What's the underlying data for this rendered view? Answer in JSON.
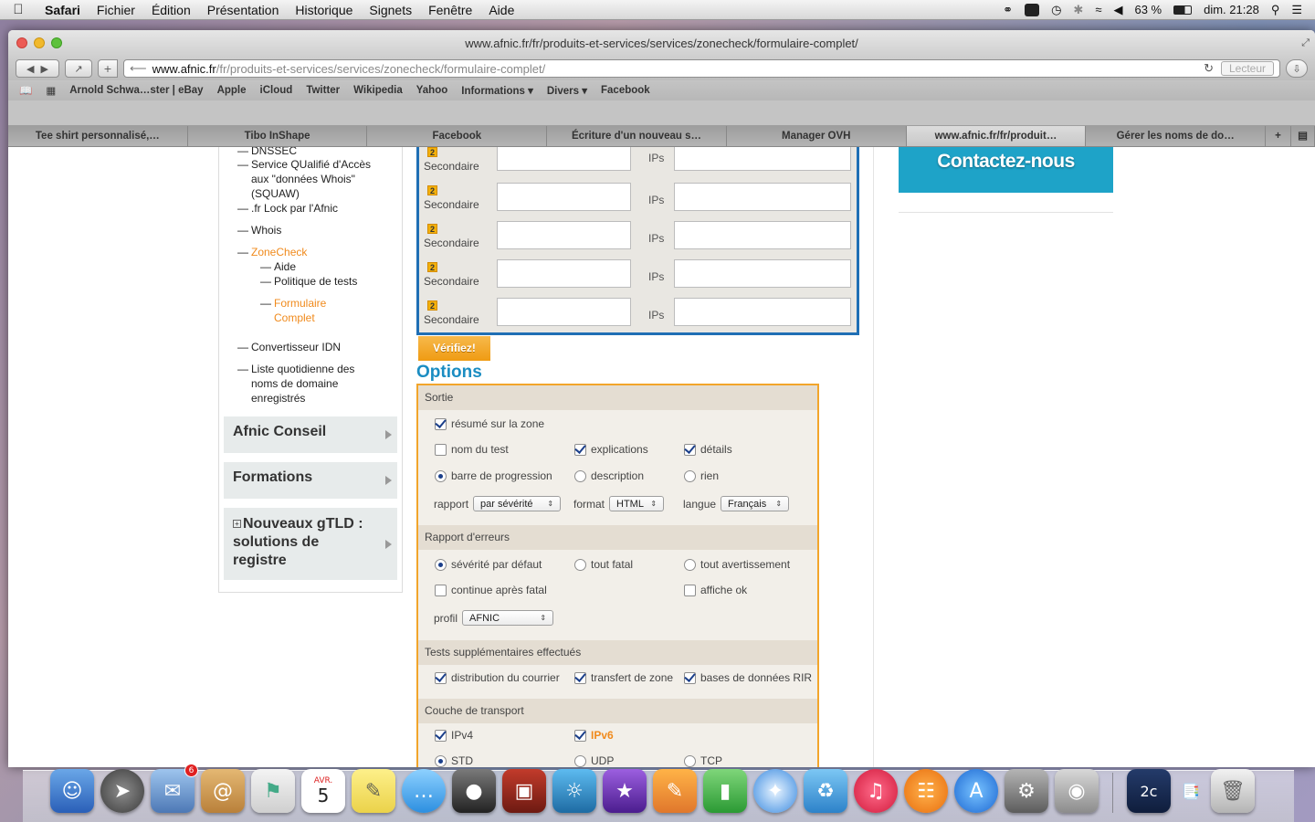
{
  "menubar": {
    "app": "Safari",
    "items": [
      "Fichier",
      "Édition",
      "Présentation",
      "Historique",
      "Signets",
      "Fenêtre",
      "Aide"
    ],
    "battery": "63 %",
    "clock": "dim. 21:28"
  },
  "window": {
    "title": "www.afnic.fr/fr/produits-et-services/services/zonecheck/formulaire-complet/",
    "url_host": "www.afnic.fr",
    "url_path": "/fr/produits-et-services/services/zonecheck/formulaire-complet/",
    "reader_label": "Lecteur"
  },
  "bookmarks": [
    "Arnold Schwa…ster | eBay",
    "Apple",
    "iCloud",
    "Twitter",
    "Wikipedia",
    "Yahoo",
    "Informations ▾",
    "Divers ▾",
    "Facebook"
  ],
  "tabs": [
    "Tee shirt personnalisé,…",
    "Tibo InShape",
    "Facebook",
    "Écriture d'un nouveau s…",
    "Manager OVH",
    "www.afnic.fr/fr/produit…",
    "Gérer les noms de do…"
  ],
  "sidebar": {
    "items": [
      {
        "dash": "—",
        "text": "DNSSEC"
      },
      {
        "dash": "—",
        "text": "Service QUalifié d'Accès aux \"données Whois\" (SQUAW)"
      },
      {
        "dash": "—",
        "text": ".fr Lock par l'Afnic"
      },
      {
        "dash": "—",
        "text": "Whois"
      },
      {
        "dash": "—",
        "text": "ZoneCheck"
      },
      {
        "dash": "—",
        "text": "Aide"
      },
      {
        "dash": "—",
        "text": "Politique de tests"
      },
      {
        "dash": "—",
        "text": "Formulaire Complet"
      },
      {
        "dash": "—",
        "text": "Convertisseur IDN"
      },
      {
        "dash": "—",
        "text": "Liste quotidienne des noms de domaine enregistrés"
      }
    ],
    "blocks": [
      "Afnic Conseil",
      "Formations",
      "Nouveaux gTLD : solutions de registre"
    ]
  },
  "servers": {
    "rows": [
      {
        "badge": "2",
        "label": "Secondaire",
        "ips": "IPs"
      },
      {
        "badge": "2",
        "label": "Secondaire",
        "ips": "IPs"
      },
      {
        "badge": "2",
        "label": "Secondaire",
        "ips": "IPs"
      },
      {
        "badge": "2",
        "label": "Secondaire",
        "ips": "IPs"
      },
      {
        "badge": "2",
        "label": "Secondaire",
        "ips": "IPs"
      }
    ],
    "verify_label": "Vérifiez!"
  },
  "options": {
    "title": "Options",
    "sortie": {
      "heading": "Sortie",
      "resume": "résumé sur la zone",
      "nom_test": "nom du test",
      "explications": "explications",
      "details": "détails",
      "barre": "barre de progression",
      "description": "description",
      "rien": "rien",
      "rapport_label": "rapport",
      "rapport_value": "par sévérité",
      "format_label": "format",
      "format_value": "HTML",
      "langue_label": "langue",
      "langue_value": "Français"
    },
    "erreurs": {
      "heading": "Rapport d'erreurs",
      "severite": "sévérité par défaut",
      "fatal": "tout fatal",
      "avert": "tout avertissement",
      "continue": "continue après fatal",
      "affiche": "affiche ok",
      "profil_label": "profil",
      "profil_value": "AFNIC"
    },
    "tests": {
      "heading": "Tests supplémentaires effectués",
      "courrier": "distribution du courrier",
      "transfert": "transfert de zone",
      "rir": "bases de données RIR"
    },
    "transport": {
      "heading": "Couche de transport",
      "ipv4": "IPv4",
      "ipv6": "IPv6",
      "std": "STD",
      "udp": "UDP",
      "tcp": "TCP"
    }
  },
  "contact_label": "Contactez-nous",
  "dock": {
    "mail_badge": "6",
    "calendar_day": "5",
    "calendar_month": "AVR."
  }
}
